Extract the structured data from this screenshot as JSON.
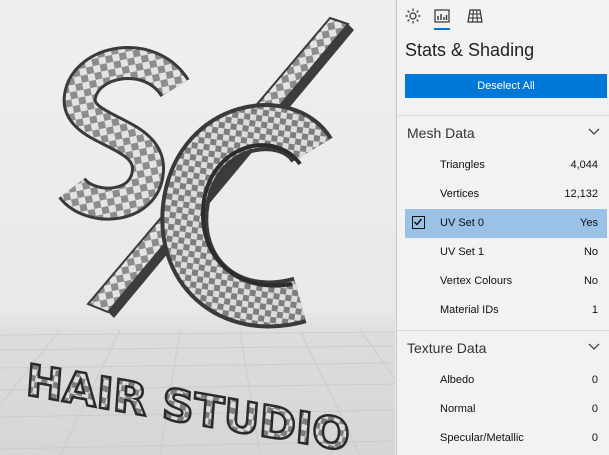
{
  "panel": {
    "title": "Stats & Shading",
    "tabs": [
      {
        "icon": "sun-icon"
      },
      {
        "icon": "stats-chart-icon"
      },
      {
        "icon": "grid-icon"
      }
    ],
    "deselect_label": "Deselect All"
  },
  "mesh": {
    "header": "Mesh Data",
    "rows": [
      {
        "label": "Triangles",
        "value": "4,044"
      },
      {
        "label": "Vertices",
        "value": "12,132"
      },
      {
        "label": "UV Set 0",
        "value": "Yes",
        "selected": true
      },
      {
        "label": "UV Set 1",
        "value": "No"
      },
      {
        "label": "Vertex Colours",
        "value": "No"
      },
      {
        "label": "Material IDs",
        "value": "1"
      }
    ]
  },
  "texture": {
    "header": "Texture Data",
    "rows": [
      {
        "label": "Albedo",
        "value": "0"
      },
      {
        "label": "Normal",
        "value": "0"
      },
      {
        "label": "Specular/Metallic",
        "value": "0"
      }
    ]
  },
  "viewport": {
    "model_text": "HAIR STUDIO"
  },
  "colors": {
    "accent": "#0078d7",
    "selected_row": "#99c2e6",
    "checker_light": "#e2e2e2",
    "checker_dark": "#8a8a8a"
  }
}
